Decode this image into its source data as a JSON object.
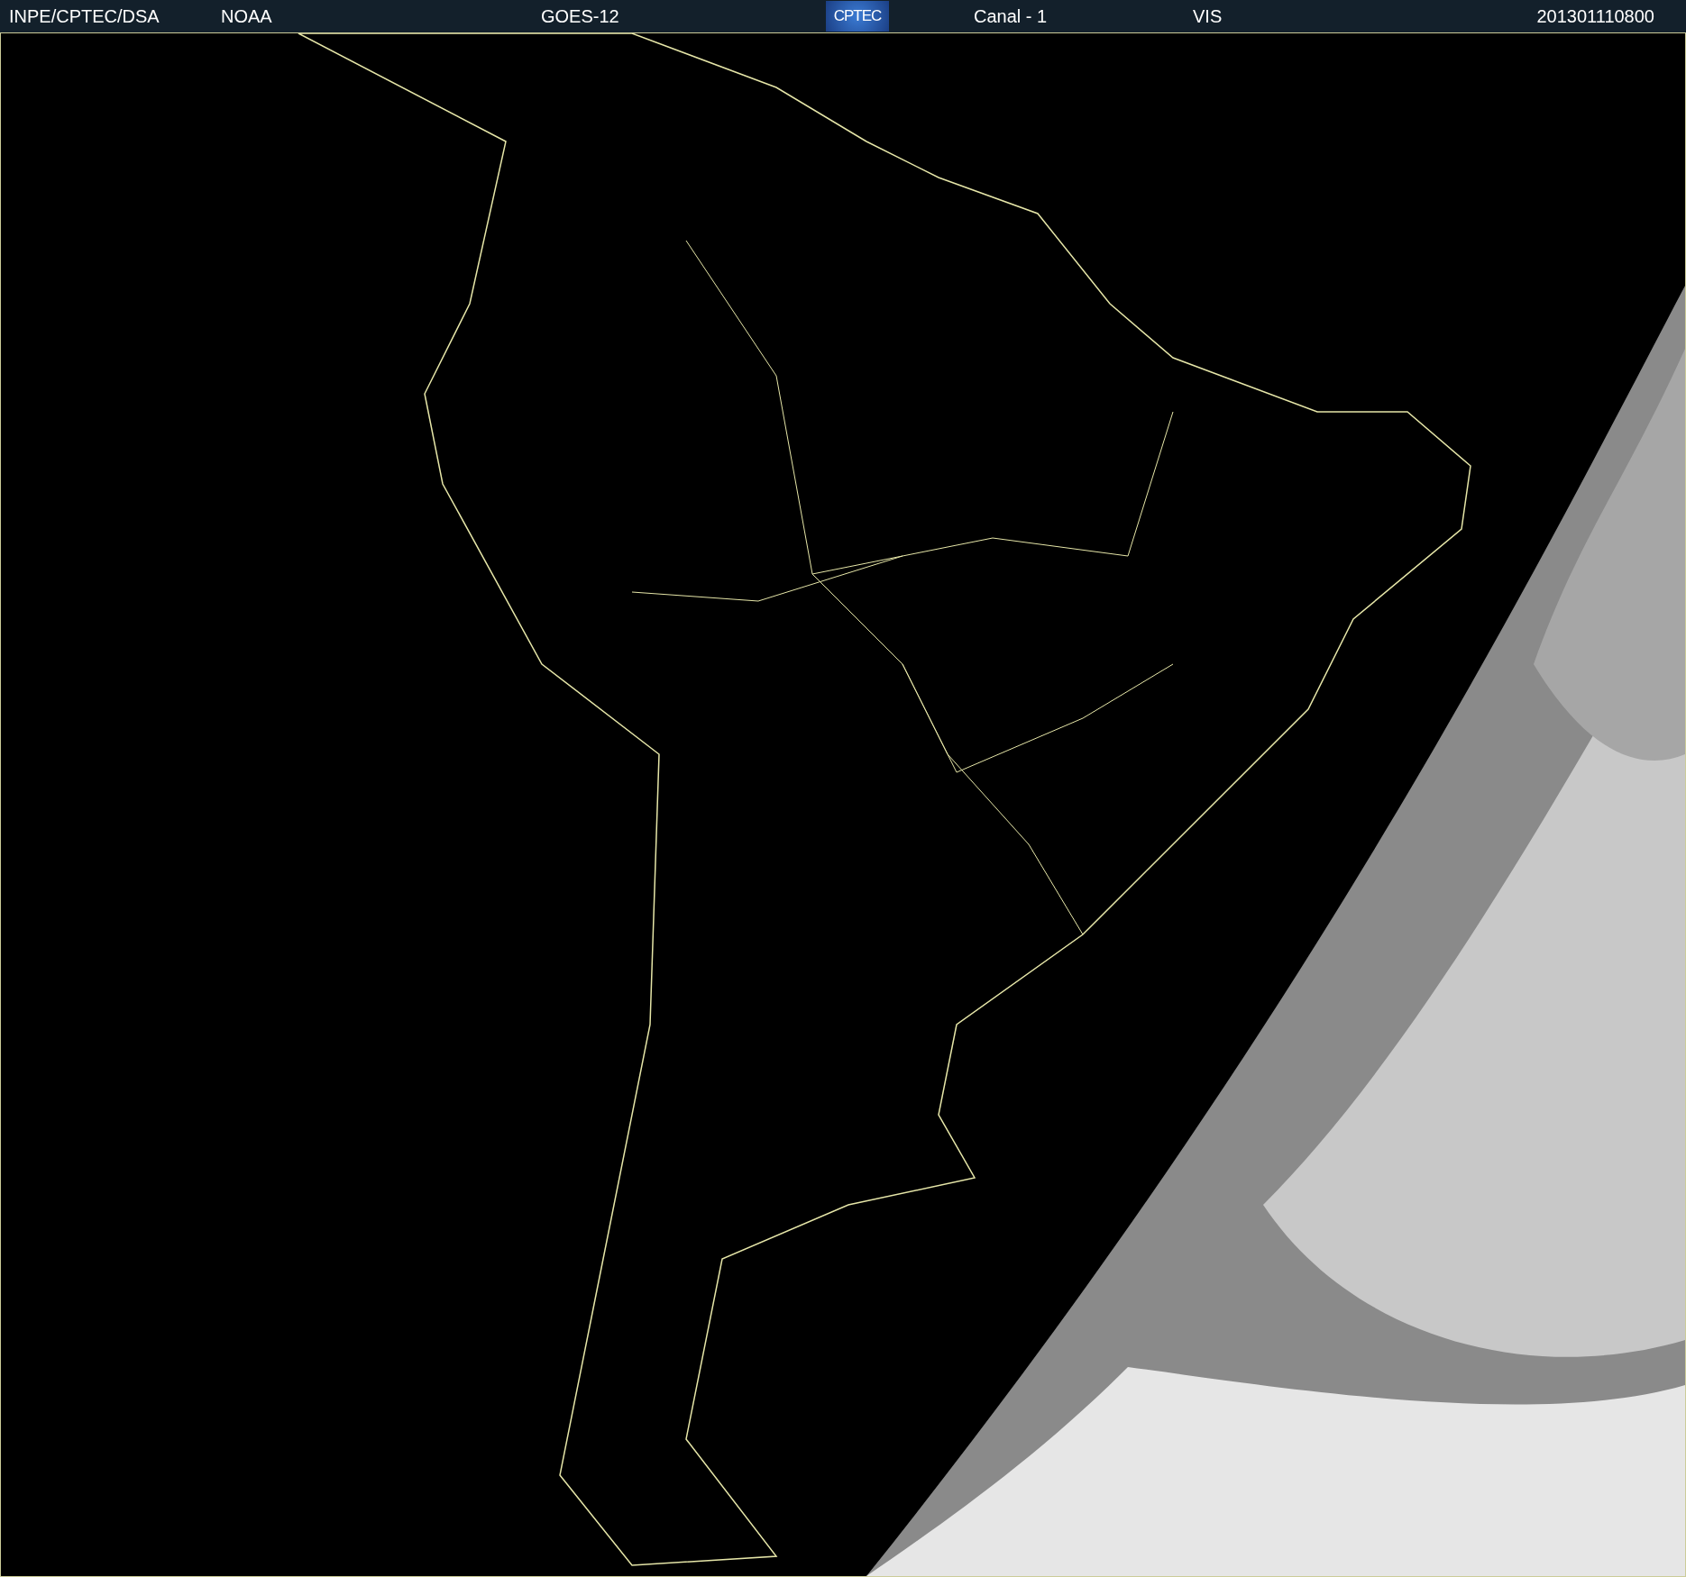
{
  "header": {
    "source": "INPE/CPTEC/DSA",
    "agency": "NOAA",
    "satellite": "GOES-12",
    "logo": "CPTEC",
    "channel": "Canal - 1",
    "band": "VIS",
    "timestamp": "201301110800"
  }
}
